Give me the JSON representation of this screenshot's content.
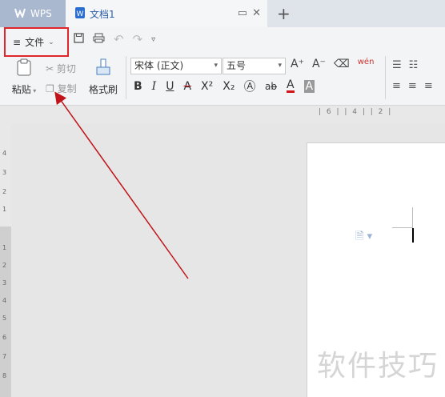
{
  "tabs": {
    "app_label": "WPS",
    "doc_label": "文档1",
    "new_tab": "+"
  },
  "file_menu": {
    "label": "文件"
  },
  "clipboard": {
    "paste": "粘贴",
    "cut": "剪切",
    "copy": "复制",
    "format_painter": "格式刷"
  },
  "font": {
    "family": "宋体 (正文)",
    "size": "五号"
  },
  "format_buttons": {
    "bold": "B",
    "italic": "I",
    "underline": "U",
    "strikethrough": "A",
    "superscript": "X²",
    "subscript": "X₂",
    "text_effect": "A",
    "font_color": "A",
    "char_shading": "A",
    "grow_font": "A⁺",
    "shrink_font": "A⁻",
    "phonetic": "wén"
  },
  "ruler": {
    "h_ticks": "| 6 |   | 4 |   | 2 |",
    "v_ticks": [
      "4",
      "3",
      "2",
      "1",
      "1",
      "2",
      "3",
      "4",
      "5",
      "6",
      "7",
      "8"
    ]
  },
  "watermark": "软件技巧",
  "colors": {
    "highlight_box": "#e0262b",
    "arrow": "#c0141a",
    "wps_tab": "#a9b7cf"
  }
}
